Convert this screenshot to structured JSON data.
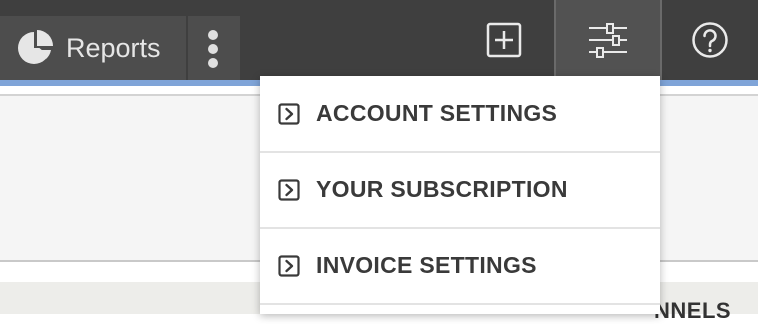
{
  "topbar": {
    "reports_label": "Reports",
    "reports_icon": "pie-chart-icon",
    "more_icon": "vertical-ellipsis-icon",
    "add_icon": "add-square-icon",
    "settings_icon": "sliders-icon",
    "help_icon": "help-circle-icon"
  },
  "settings_menu": {
    "items": [
      {
        "label": "ACCOUNT SETTINGS",
        "icon": "chevron-right-square-icon"
      },
      {
        "label": "YOUR SUBSCRIPTION",
        "icon": "chevron-right-square-icon"
      },
      {
        "label": "INVOICE SETTINGS",
        "icon": "chevron-right-square-icon"
      }
    ]
  },
  "background": {
    "column_heading_partial": "NNELS"
  },
  "colors": {
    "topbar_bg": "#3f3f3f",
    "accent_strip": "#7fa4d8",
    "menu_text": "#3a3a3a"
  }
}
